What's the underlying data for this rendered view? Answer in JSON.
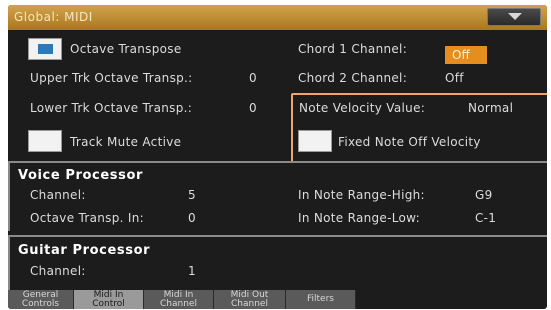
{
  "window": {
    "title": "Global: MIDI"
  },
  "left_column": {
    "octave_transpose": {
      "label": "Octave Transpose",
      "checked": true
    },
    "upper_trk": {
      "label": "Upper Trk Octave Transp.:",
      "value": "0"
    },
    "lower_trk": {
      "label": "Lower Trk Octave Transp.:",
      "value": "0"
    },
    "track_mute": {
      "label": "Track Mute Active",
      "checked": false
    }
  },
  "right_column": {
    "chord1": {
      "label": "Chord 1 Channel:",
      "value": "Off"
    },
    "chord2": {
      "label": "Chord 2 Channel:",
      "value": "Off"
    },
    "note_velocity": {
      "label": "Note Velocity Value:",
      "value": "Normal"
    },
    "fixed_note_off": {
      "label": "Fixed Note Off Velocity",
      "checked": false
    }
  },
  "voice_processor": {
    "heading": "Voice Processor",
    "channel": {
      "label": "Channel:",
      "value": "5"
    },
    "octave_transp_in": {
      "label": "Octave Transp. In:",
      "value": "0"
    },
    "range_high": {
      "label": "In Note Range-High:",
      "value": "G9"
    },
    "range_low": {
      "label": "In Note Range-Low:",
      "value": "C-1"
    }
  },
  "guitar_processor": {
    "heading": "Guitar Processor",
    "channel": {
      "label": "Channel:",
      "value": "1"
    }
  },
  "tabs": [
    {
      "line1": "General",
      "line2": "Controls",
      "active": false
    },
    {
      "line1": "Midi In",
      "line2": "Control",
      "active": true
    },
    {
      "line1": "Midi In",
      "line2": "Channel",
      "active": false
    },
    {
      "line1": "Midi Out",
      "line2": "Channel",
      "active": false
    },
    {
      "line1": "Filters",
      "line2": "",
      "active": false
    }
  ],
  "colors": {
    "title_bar": "#c18f36",
    "background": "#1c1c1c",
    "accent_orange": "#e58d1e",
    "highlight_border": "#f3a46a",
    "checkbox_fill": "#2d78b8"
  }
}
